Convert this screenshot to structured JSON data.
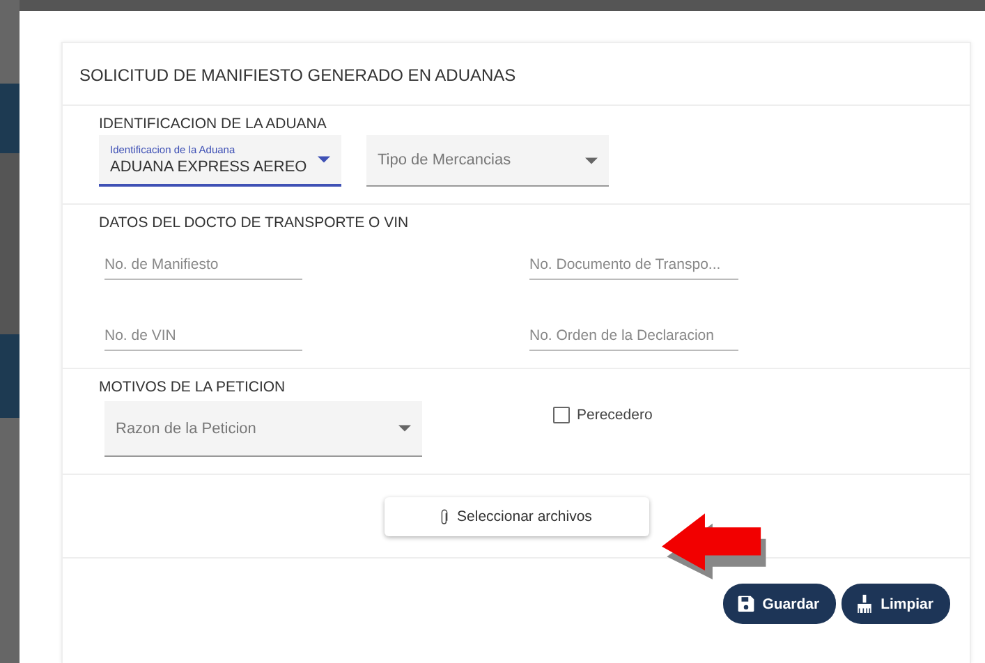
{
  "card": {
    "title": "SOLICITUD DE MANIFIESTO GENERADO EN ADUANAS"
  },
  "aduana_section": {
    "heading": "IDENTIFICACION DE LA ADUANA",
    "selects": [
      {
        "label": "Identificacion de la Aduana",
        "value": "ADUANA EXPRESS AEREO",
        "focused": true
      },
      {
        "placeholder": "Tipo de Mercancias",
        "focused": false
      }
    ]
  },
  "transporte_section": {
    "heading": "DATOS DEL DOCTO DE TRANSPORTE O VIN",
    "fields": [
      {
        "placeholder": "No. de Manifiesto"
      },
      {
        "placeholder": "No. Documento de Transpo..."
      },
      {
        "placeholder": "No. de VIN"
      },
      {
        "placeholder": "No. Orden de la Declaracion"
      }
    ]
  },
  "motivos_section": {
    "heading": "MOTIVOS DE LA PETICION",
    "select": {
      "placeholder": "Razon de la Peticion"
    },
    "checkbox": {
      "label": "Perecedero",
      "checked": false
    }
  },
  "attach_button": {
    "label": "Seleccionar archivos"
  },
  "actions": [
    {
      "kind": "save",
      "label": "Guardar"
    },
    {
      "kind": "clear",
      "label": "Limpiar"
    }
  ]
}
